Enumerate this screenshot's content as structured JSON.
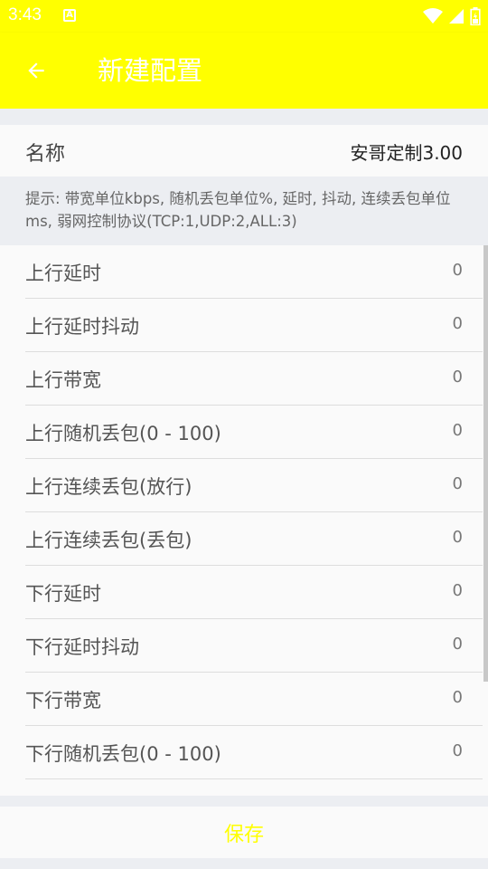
{
  "status_bar": {
    "time": "3:43",
    "notification_icon": "a-notification-icon",
    "wifi_icon": "wifi-icon",
    "signal_icon": "signal-icon",
    "battery_icon": "battery-icon"
  },
  "app_bar": {
    "title": "新建配置",
    "back_icon": "arrow-left-icon"
  },
  "name_field": {
    "label": "名称",
    "value": "安哥定制3.00"
  },
  "hint": "提示: 带宽单位kbps, 随机丢包单位%, 延时, 抖动, 连续丢包单位ms, 弱网控制协议(TCP:1,UDP:2,ALL:3)",
  "items": [
    {
      "label": "上行延时",
      "value": "0"
    },
    {
      "label": "上行延时抖动",
      "value": "0"
    },
    {
      "label": "上行带宽",
      "value": "0"
    },
    {
      "label": "上行随机丢包(0 - 100)",
      "value": "0"
    },
    {
      "label": "上行连续丢包(放行)",
      "value": "0"
    },
    {
      "label": "上行连续丢包(丢包)",
      "value": "0"
    },
    {
      "label": "下行延时",
      "value": "0"
    },
    {
      "label": "下行延时抖动",
      "value": "0"
    },
    {
      "label": "下行带宽",
      "value": "0"
    },
    {
      "label": "下行随机丢包(0 - 100)",
      "value": "0"
    }
  ],
  "save_button": {
    "label": "保存"
  },
  "colors": {
    "primary": "#ffff00",
    "on_primary": "#ffffff",
    "background": "#eceef2",
    "surface": "#fafafa"
  }
}
